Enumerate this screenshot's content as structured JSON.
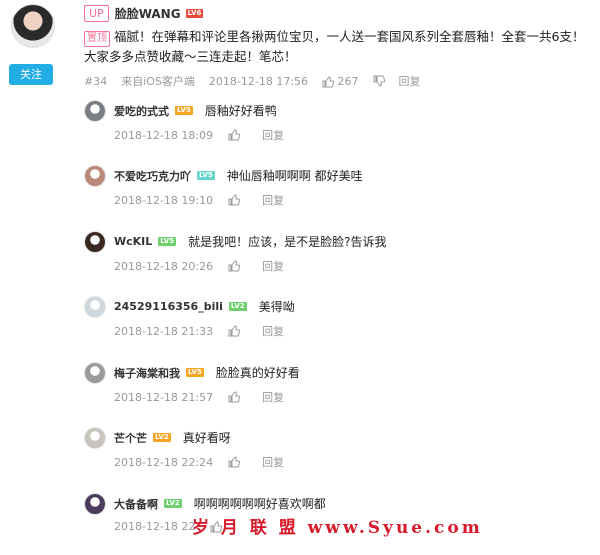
{
  "main_post": {
    "follow_label": "关注",
    "up_badge": "UP",
    "username": "脸脸WANG",
    "level": "LV6",
    "pinned_badge": "置顶",
    "text": "福腻！在弹幕和评论里各揪两位宝贝，一人送一套国风系列全套唇釉！全套一共6支！大家多多点赞收藏～三连走起！笔芯！",
    "floor": "#34",
    "client": "来自iOS客户端",
    "timestamp": "2018-12-18 17:56",
    "like_count": "267",
    "reply_label": "回复"
  },
  "replies": [
    {
      "username": "爱吃的式式",
      "level": "LV5",
      "level_color": "orange",
      "text": "唇釉好好看鸭",
      "timestamp": "2018-12-18 18:09",
      "reply_label": "回复",
      "avatar_color": "#7a7f86"
    },
    {
      "username": "不爱吃巧克力吖",
      "level": "LV5",
      "level_color": "teal",
      "text": "神仙唇釉啊啊啊 都好美哇",
      "timestamp": "2018-12-18 19:10",
      "reply_label": "回复",
      "avatar_color": "#b98a7a"
    },
    {
      "username": "WcKIL",
      "level": "LV5",
      "level_color": "green",
      "text": "就是我吧！应该，是不是脸脸?告诉我",
      "timestamp": "2018-12-18 20:26",
      "reply_label": "回复",
      "avatar_color": "#3b2a22"
    },
    {
      "username": "24529116356_bili",
      "level": "LV2",
      "level_color": "green",
      "text": "美得呦",
      "timestamp": "2018-12-18 21:33",
      "reply_label": "回复",
      "avatar_color": "#cfd8dc"
    },
    {
      "username": "梅子海棠和我",
      "level": "LV5",
      "level_color": "orange",
      "text": "脸脸真的好好看",
      "timestamp": "2018-12-18 21:57",
      "reply_label": "回复",
      "avatar_color": "#9a9a9a"
    },
    {
      "username": "芒个芒",
      "level": "LV2",
      "level_color": "orange",
      "text": "真好看呀",
      "timestamp": "2018-12-18 22:24",
      "reply_label": "回复",
      "avatar_color": "#c9c4bd"
    },
    {
      "username": "大备备啊",
      "level": "LV2",
      "level_color": "green",
      "text": "啊啊啊啊啊啊好喜欢啊都",
      "timestamp": "2018-12-18 22",
      "reply_label": "",
      "avatar_color": "#4b3b5c"
    }
  ],
  "watermark": "岁 月 联 盟  www.Syue.com"
}
